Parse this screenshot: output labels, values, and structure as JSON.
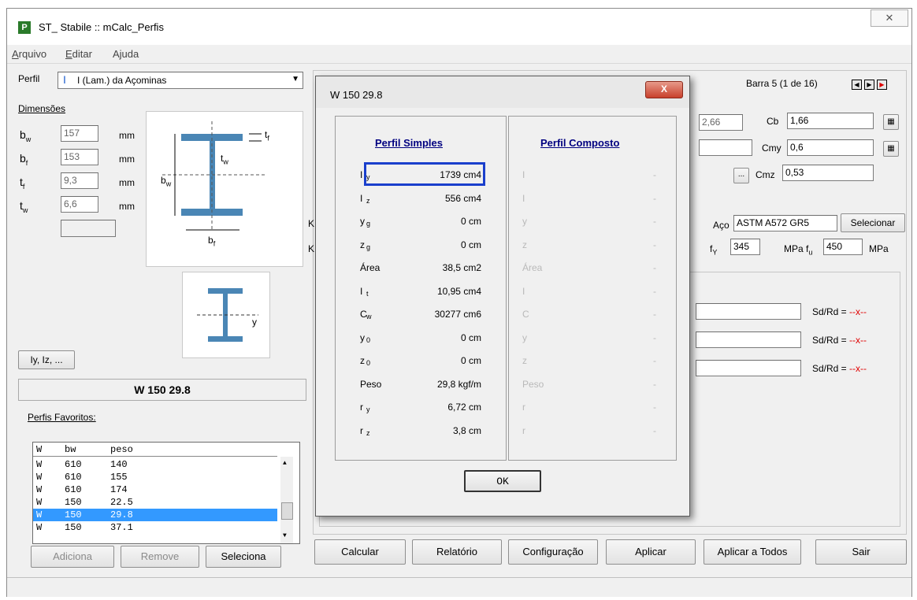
{
  "window": {
    "title": "ST_ Stabile :: mCalc_Perfis",
    "close_glyph": "✕",
    "app_icon_letter": "P"
  },
  "menu": [
    {
      "label": "Arquivo",
      "underline": "A",
      "rest": "rquivo"
    },
    {
      "label": "Editar",
      "underline": "E",
      "rest": "ditar"
    },
    {
      "label": "Ajuda",
      "underline": "",
      "rest": "Ajuda"
    }
  ],
  "left": {
    "perfil_label": "Perfil",
    "perfil_value": "I (Lam.) da Açominas",
    "dimensoes_label": "Dimensões",
    "dims": [
      {
        "sym": "b",
        "sub": "w",
        "value": "157",
        "unit": "mm"
      },
      {
        "sym": "b",
        "sub": "f",
        "value": "153",
        "unit": "mm"
      },
      {
        "sym": "t",
        "sub": "f",
        "value": "9,3",
        "unit": "mm"
      },
      {
        "sym": "t",
        "sub": "w",
        "value": "6,6",
        "unit": "mm"
      }
    ],
    "diagram_labels": {
      "tf": "t",
      "tw": "t",
      "bw": "b",
      "bf": "b"
    },
    "axis_label": "y",
    "iy_button": "Iy, Iz, ...",
    "profile_name": "W 150 29.8",
    "favoritos_label": "Perfis Favoritos:",
    "list_headers": [
      "W",
      "bw",
      "peso"
    ],
    "list_rows": [
      [
        "W",
        "610",
        "140"
      ],
      [
        "W",
        "610",
        "155"
      ],
      [
        "W",
        "610",
        "174"
      ],
      [
        "W",
        "150",
        "22.5"
      ],
      [
        "W",
        "150",
        "29.8"
      ],
      [
        "W",
        "150",
        "37.1"
      ]
    ],
    "selected_row": 4,
    "buttons": {
      "adiciona": "Adiciona",
      "remove": "Remove",
      "seleciona": "Seleciona"
    }
  },
  "right": {
    "barra": "Barra 5 (1 de 16)",
    "field_266": "2,66",
    "cb_label": "Cb",
    "cb_value": "1,66",
    "cmy_label": "Cmy",
    "cmy_value": "0,6",
    "cmz_label": "Cmz",
    "cmz_value": "0,53",
    "dots": "...",
    "aco_label": "Aço",
    "aco_value": "ASTM A572 GR5",
    "selecionar": "Selecionar",
    "fy_label": "f",
    "fy_sub": "Y",
    "fy_value": "345",
    "fu_label": "MPa  f",
    "fu_sub": "u",
    "fu_value": "450",
    "mpa": "MPa",
    "sdrd": [
      "Sd/Rd = ",
      "Sd/Rd = ",
      "Sd/Rd = "
    ],
    "sdrd_val": "--x--",
    "k_labels": [
      "K",
      "K"
    ]
  },
  "bottom_buttons": [
    "Calcular",
    "Relatório",
    "Configuração",
    "Aplicar",
    "Aplicar a Todos",
    "Sair"
  ],
  "dialog": {
    "title": "W 150 29.8",
    "close": "X",
    "simples_header": "Perfil Simples",
    "composto_header": "Perfil Composto",
    "rows": [
      {
        "label": "I",
        "sub": "y",
        "value": "1739 cm4"
      },
      {
        "label": "I",
        "sub": "z",
        "value": "556 cm4"
      },
      {
        "label": "y",
        "sub": "g",
        "value": "0 cm"
      },
      {
        "label": "z",
        "sub": "g",
        "value": "0 cm"
      },
      {
        "label": "Área",
        "sub": "",
        "value": "38,5 cm2"
      },
      {
        "label": "I",
        "sub": "t",
        "value": "10,95 cm4"
      },
      {
        "label": "C",
        "sub": "w",
        "value": "30277 cm6"
      },
      {
        "label": "y",
        "sub": "0",
        "value": "0 cm"
      },
      {
        "label": "z",
        "sub": "0",
        "value": "0 cm"
      },
      {
        "label": "Peso",
        "sub": "",
        "value": "29,8 kgf/m"
      },
      {
        "label": "r",
        "sub": "y",
        "value": "6,72 cm"
      },
      {
        "label": "r",
        "sub": "z",
        "value": "3,8 cm"
      }
    ],
    "composto_dash": "-",
    "ok": "OK",
    "highlight_color": "#1a3fcc"
  }
}
